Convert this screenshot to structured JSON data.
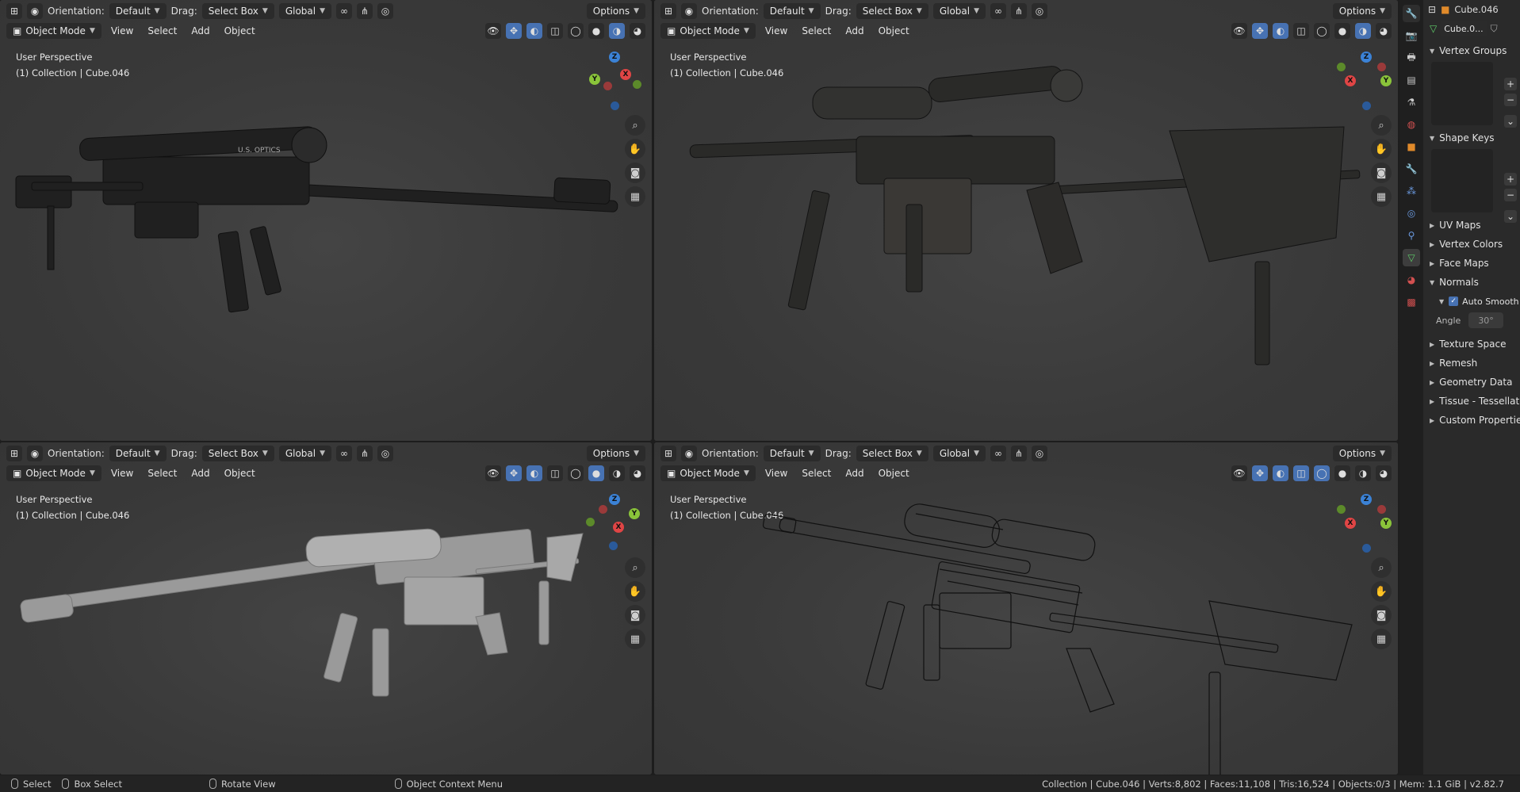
{
  "header": {
    "orientation_label": "Orientation:",
    "orientation_value": "Default",
    "drag_label": "Drag:",
    "drag_value": "Select Box",
    "transform_value": "Global",
    "options_label": "Options",
    "mode_value": "Object Mode",
    "menu_view": "View",
    "menu_select": "Select",
    "menu_add": "Add",
    "menu_object": "Object"
  },
  "viewports": [
    {
      "info_line1": "User Perspective",
      "info_line2": "(1) Collection | Cube.046",
      "shading": "material"
    },
    {
      "info_line1": "User Perspective",
      "info_line2": "(1) Collection | Cube.046",
      "shading": "material"
    },
    {
      "info_line1": "User Perspective",
      "info_line2": "(1) Collection | Cube.046",
      "shading": "solid"
    },
    {
      "info_line1": "User Perspective",
      "info_line2": "(1) Collection | Cube.046",
      "shading": "wireframe"
    }
  ],
  "gizmo": {
    "x": "X",
    "y": "Y",
    "z": "Z",
    "x_color": "#e04545",
    "y_color": "#8ac43a",
    "z_color": "#3b82d6"
  },
  "model": {
    "scope_text": "U.S. OPTICS"
  },
  "properties": {
    "object_name": "Cube.046",
    "data_name": "Cube.0...",
    "sections": {
      "vertex_groups": "Vertex Groups",
      "shape_keys": "Shape Keys",
      "uv_maps": "UV Maps",
      "vertex_colors": "Vertex Colors",
      "face_maps": "Face Maps",
      "normals": "Normals",
      "auto_smooth": "Auto Smooth",
      "angle_label": "Angle",
      "angle_value": "30°",
      "texture_space": "Texture Space",
      "remesh": "Remesh",
      "geometry_data": "Geometry Data",
      "tissue": "Tissue - Tessellate",
      "custom_properties": "Custom Properties"
    }
  },
  "statusbar": {
    "select": "Select",
    "box_select": "Box Select",
    "rotate_view": "Rotate View",
    "context_menu": "Object Context Menu",
    "stats": "Collection | Cube.046 | Verts:8,802 | Faces:11,108 | Tris:16,524 | Objects:0/3 | Mem: 1.1 GiB | v2.82.7"
  },
  "colors": {
    "accent": "#4772b3",
    "viewport_bg": "#3a3a3a",
    "header_bg": "#2b2b2b"
  }
}
